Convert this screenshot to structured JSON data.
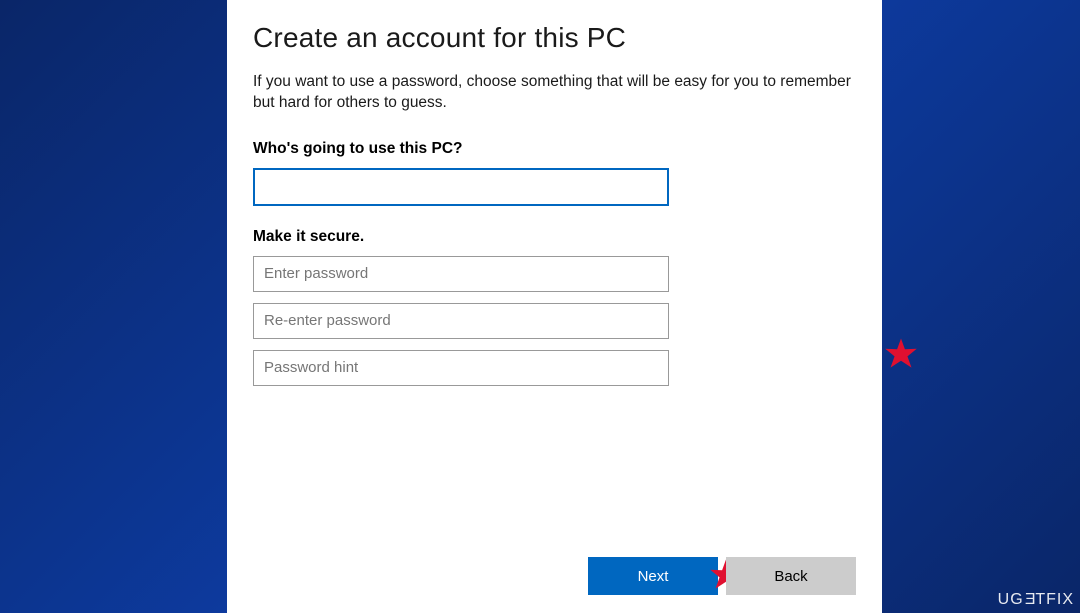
{
  "dialog": {
    "title": "Create an account for this PC",
    "description": "If you want to use a password, choose something that will be easy for you to remember but hard for others to guess."
  },
  "username_section": {
    "label": "Who's going to use this PC?",
    "value": ""
  },
  "password_section": {
    "label": "Make it secure.",
    "password_placeholder": "Enter password",
    "confirm_placeholder": "Re-enter password",
    "hint_placeholder": "Password hint"
  },
  "buttons": {
    "next": "Next",
    "back": "Back"
  },
  "watermark": {
    "part1": "UG",
    "flip": "E",
    "part2": "TFIX"
  }
}
